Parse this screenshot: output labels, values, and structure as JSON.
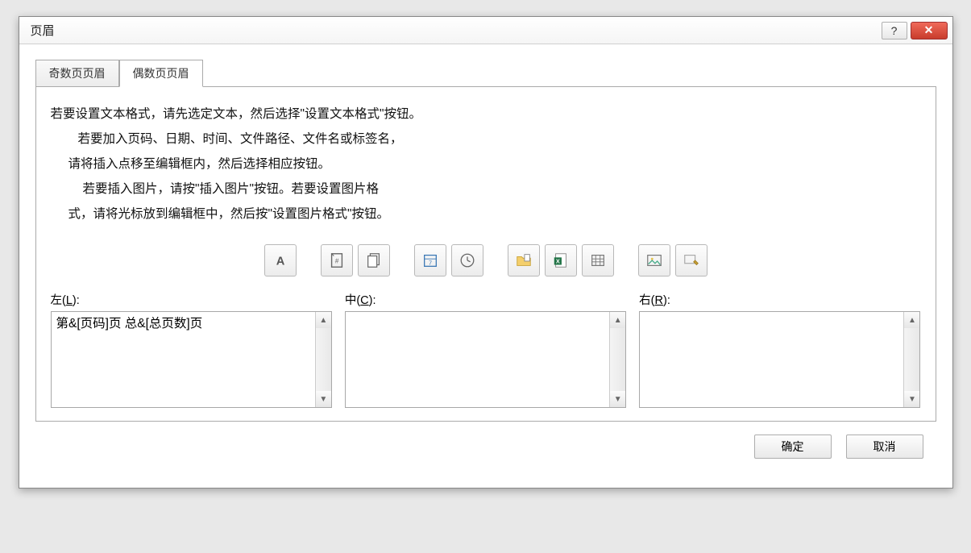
{
  "dialog": {
    "title": "页眉"
  },
  "winbuttons": {
    "help": "?",
    "close": "✕"
  },
  "tabs": {
    "odd": "奇数页页眉",
    "even": "偶数页页眉"
  },
  "instructions": {
    "l1": "若要设置文本格式，请先选定文本，然后选择\"设置文本格式\"按钮。",
    "l2": "若要加入页码、日期、时间、文件路径、文件名或标签名，",
    "l3": "请将插入点移至编辑框内，然后选择相应按钮。",
    "l4": "若要插入图片，请按\"插入图片\"按钮。若要设置图片格",
    "l5": "式，请将光标放到编辑框中，然后按\"设置图片格式\"按钮。"
  },
  "toolbar": [
    {
      "name": "format-text"
    },
    {
      "name": "page-number"
    },
    {
      "name": "number-of-pages"
    },
    {
      "name": "date"
    },
    {
      "name": "time"
    },
    {
      "name": "file-path"
    },
    {
      "name": "file-name"
    },
    {
      "name": "sheet-name"
    },
    {
      "name": "insert-picture"
    },
    {
      "name": "format-picture"
    }
  ],
  "sections": {
    "left": {
      "label_prefix": "左(",
      "mnemonic": "L",
      "label_suffix": "):",
      "value": "第&[页码]页 总&[总页数]页"
    },
    "center": {
      "label_prefix": "中(",
      "mnemonic": "C",
      "label_suffix": "):",
      "value": ""
    },
    "right": {
      "label_prefix": "右(",
      "mnemonic": "R",
      "label_suffix": "):",
      "value": ""
    }
  },
  "buttons": {
    "ok": "确定",
    "cancel": "取消"
  }
}
